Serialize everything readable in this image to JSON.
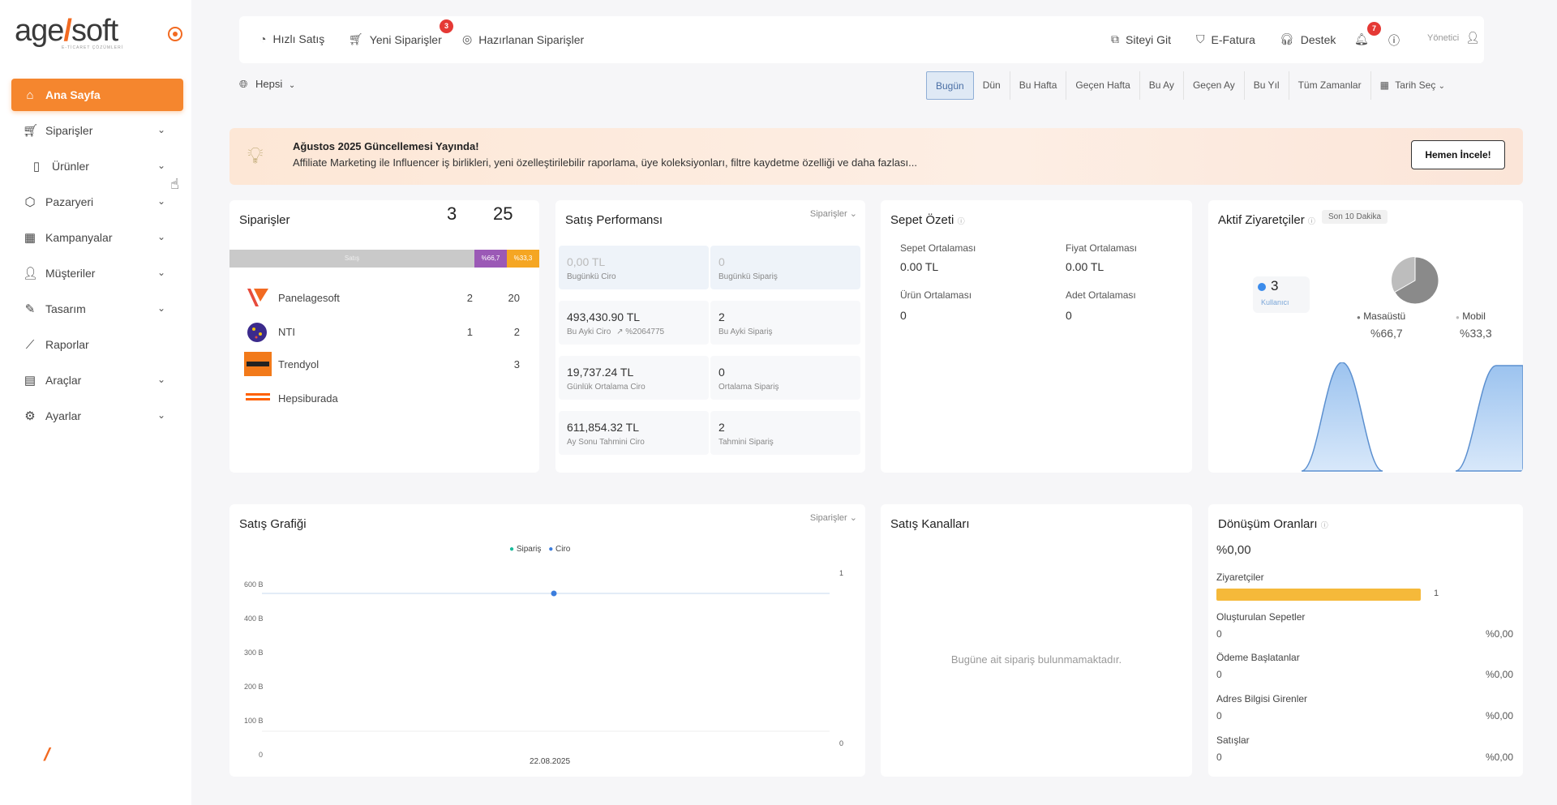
{
  "brand": {
    "name_left": "age",
    "name_right": "soft",
    "tagline": "E-TİCARET ÇÖZÜMLERİ"
  },
  "sidebar": {
    "items": [
      {
        "label": "Ana Sayfa",
        "icon": "home-icon",
        "active": true
      },
      {
        "label": "Siparişler",
        "icon": "cart-icon"
      },
      {
        "label": "Ürünler",
        "icon": "book-icon"
      },
      {
        "label": "Pazaryeri",
        "icon": "box-icon"
      },
      {
        "label": "Kampanyalar",
        "icon": "calendar-icon"
      },
      {
        "label": "Müşteriler",
        "icon": "user-icon"
      },
      {
        "label": "Tasarım",
        "icon": "brush-icon"
      },
      {
        "label": "Raporlar",
        "icon": "chart-icon"
      },
      {
        "label": "Araçlar",
        "icon": "toolbox-icon"
      },
      {
        "label": "Ayarlar",
        "icon": "gear-icon"
      }
    ]
  },
  "topbar": {
    "quick_sale": "Hızlı Satış",
    "new_orders": "Yeni Siparişler",
    "new_orders_badge": "3",
    "prepared_orders": "Hazırlanan Siparişler",
    "go_site": "Siteyi Git",
    "efatura": "E-Fatura",
    "support": "Destek",
    "notif_badge": "7",
    "user": "Yönetici"
  },
  "filter": {
    "scope": "Hepsi",
    "ranges": [
      "Bugün",
      "Dün",
      "Bu Hafta",
      "Geçen Hafta",
      "Bu Ay",
      "Geçen Ay",
      "Bu Yıl",
      "Tüm Zamanlar"
    ],
    "active": "Bugün",
    "date_pick": "Tarih Seç"
  },
  "announcement": {
    "title": "Ağustos 2025 Güncellemesi Yayında!",
    "desc": "Affiliate Marketing ile Influencer iş birlikleri, yeni özelleştirilebilir raporlama, üye koleksiyonları, filtre kaydetme özelliği ve daha fazlası...",
    "button": "Hemen İncele!"
  },
  "orders_card": {
    "title": "Siparişler",
    "count_a": "3",
    "count_b": "25",
    "bar": {
      "gray_label": "Satış",
      "purple_label": "%66,7",
      "orange_label": "%33,3"
    },
    "rows": [
      {
        "name": "Panelagesoft",
        "a": "2",
        "b": "20"
      },
      {
        "name": "NTI",
        "a": "1",
        "b": "2"
      },
      {
        "name": "Trendyol",
        "a": "",
        "b": "3"
      },
      {
        "name": "Hepsiburada",
        "a": "",
        "b": ""
      }
    ]
  },
  "performance": {
    "title": "Satış Performansı",
    "dropdown": "Siparişler",
    "cells": [
      {
        "value": "0,00 TL",
        "label": "Bugünkü Ciro"
      },
      {
        "value": "0",
        "label": "Bugünkü Sipariş"
      },
      {
        "value": "493,430.90 TL",
        "label": "Bu Ayki Ciro",
        "extra": "%2064775"
      },
      {
        "value": "2",
        "label": "Bu Ayki Sipariş"
      },
      {
        "value": "19,737.24 TL",
        "label": "Günlük Ortalama Ciro"
      },
      {
        "value": "0",
        "label": "Ortalama Sipariş"
      },
      {
        "value": "611,854.32 TL",
        "label": "Ay Sonu Tahmini Ciro"
      },
      {
        "value": "2",
        "label": "Tahmini Sipariş"
      }
    ]
  },
  "basket": {
    "title": "Sepet Özeti",
    "items": [
      {
        "label": "Sepet Ortalaması",
        "value": "0.00 TL"
      },
      {
        "label": "Fiyat Ortalaması",
        "value": "0.00 TL"
      },
      {
        "label": "Ürün Ortalaması",
        "value": "0"
      },
      {
        "label": "Adet Ortalaması",
        "value": "0"
      }
    ]
  },
  "visitors": {
    "title": "Aktif Ziyaretçiler",
    "period": "Son 10 Dakika",
    "count": "3",
    "count_label": "Kullanıcı",
    "desktop_label": "Masaüstü",
    "desktop_pct": "%66,7",
    "mobile_label": "Mobil",
    "mobile_pct": "%33,3",
    "desktop_share": 0.667,
    "colors": {
      "pie_main": "#8a8a8a",
      "pie_light": "#bdbdbd",
      "wave": "#9cc3ef"
    }
  },
  "sales_chart": {
    "title": "Satış Grafiği",
    "dropdown": "Siparişler",
    "legend_orders": "Sipariş",
    "legend_revenue": "Ciro",
    "yticks": [
      "600 B",
      "400 B",
      "300 B",
      "200 B",
      "100 B",
      "0"
    ],
    "right_top": "1",
    "right_bottom": "0",
    "xdate": "22.08.2025",
    "colors": {
      "orders": "#1abc9c",
      "revenue": "#3b7ddd"
    }
  },
  "chart_data": {
    "type": "line",
    "categories": [
      "22.08.2025"
    ],
    "series": [
      {
        "name": "Sipariş",
        "values": [
          1
        ]
      },
      {
        "name": "Ciro",
        "values": [
          0
        ]
      }
    ],
    "title": "Satış Grafiği",
    "xlabel": "",
    "ylabel": ""
  },
  "channels": {
    "title": "Satış Kanalları",
    "empty": "Bugüne ait sipariş bulunmamaktadır."
  },
  "conversion": {
    "title": "Dönüşüm Oranları",
    "rate": "%0,00",
    "visitors_label": "Ziyaretçiler",
    "visitors_value": "1",
    "rows": [
      {
        "label": "Oluşturulan Sepetler",
        "value": "0",
        "pct": "%0,00"
      },
      {
        "label": "Ödeme Başlatanlar",
        "value": "0",
        "pct": "%0,00"
      },
      {
        "label": "Adres Bilgisi Girenler",
        "value": "0",
        "pct": "%0,00"
      },
      {
        "label": "Satışlar",
        "value": "0",
        "pct": "%0,00"
      }
    ],
    "bar_color": "#f5b93a"
  }
}
